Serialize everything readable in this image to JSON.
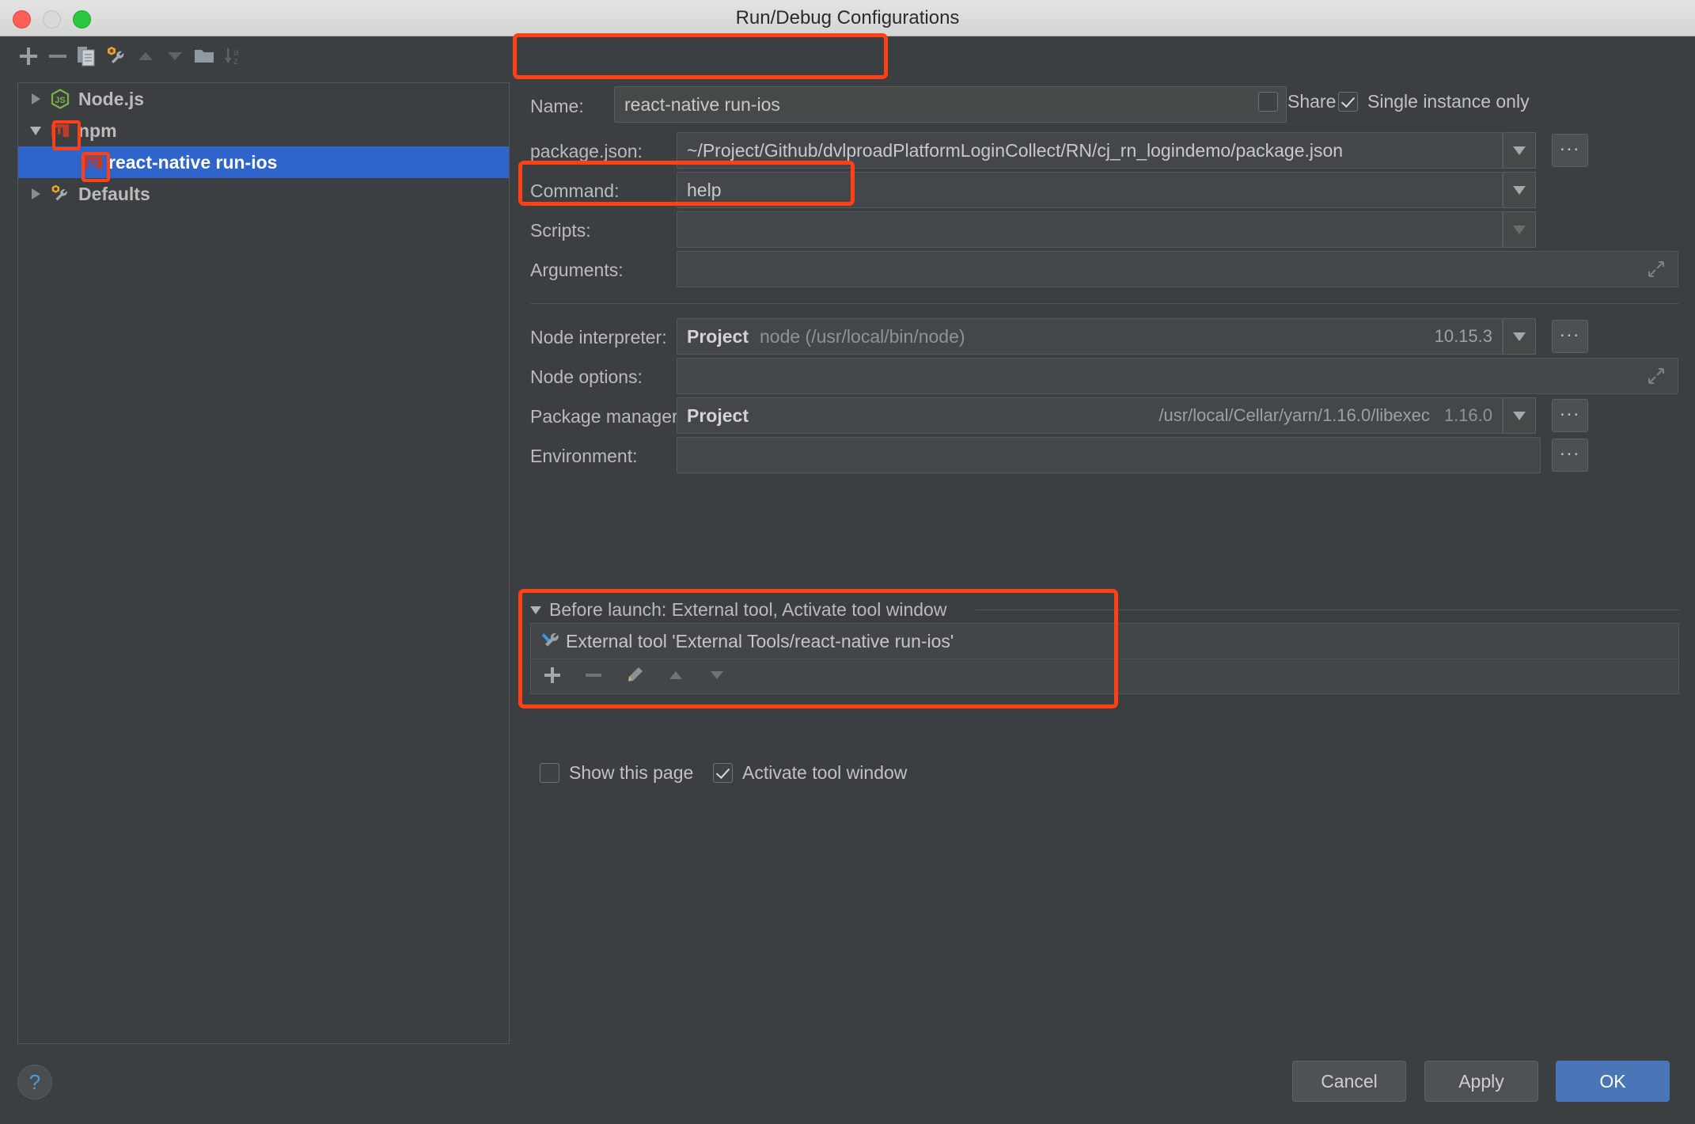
{
  "window": {
    "title": "Run/Debug Configurations",
    "traffic_lights": [
      "close",
      "minimize",
      "maximize"
    ]
  },
  "toolbar": {
    "buttons": [
      {
        "name": "add-configuration",
        "icon": "plus-icon"
      },
      {
        "name": "remove-configuration",
        "icon": "minus-icon"
      },
      {
        "name": "copy-configuration",
        "icon": "copy-icon"
      },
      {
        "name": "edit-templates",
        "icon": "wrench-gear-icon"
      },
      {
        "name": "move-up",
        "icon": "arrow-up-icon"
      },
      {
        "name": "move-down",
        "icon": "arrow-down-icon"
      },
      {
        "name": "create-folder",
        "icon": "folder-icon"
      },
      {
        "name": "sort-configurations",
        "icon": "sort-az-icon"
      }
    ]
  },
  "tree": {
    "items": [
      {
        "label": "Node.js",
        "icon": "nodejs-icon",
        "twisty": "right",
        "level": 1,
        "selected": false
      },
      {
        "label": "npm",
        "icon": "npm-icon",
        "twisty": "down",
        "level": 1,
        "selected": false
      },
      {
        "label": "react-native run-ios",
        "icon": "npm-icon",
        "twisty": "none",
        "level": 2,
        "selected": true
      },
      {
        "label": "Defaults",
        "icon": "wrench-gear-icon",
        "twisty": "right",
        "level": 1,
        "selected": false
      }
    ]
  },
  "form": {
    "name": {
      "label": "Name:",
      "value": "react-native run-ios"
    },
    "share": {
      "label": "Share",
      "checked": false
    },
    "single_instance": {
      "label": "Single instance only",
      "checked": true
    },
    "package_json": {
      "label": "package.json:",
      "value": "~/Project/Github/dvlproadPlatformLoginCollect/RN/cj_rn_logindemo/package.json",
      "browse_label": "..."
    },
    "command": {
      "label": "Command:",
      "value": "help"
    },
    "scripts": {
      "label": "Scripts:",
      "value": ""
    },
    "arguments": {
      "label": "Arguments:",
      "value": ""
    },
    "node_interpreter": {
      "label": "Node interpreter:",
      "scope": "Project",
      "value": "node (/usr/local/bin/node)",
      "version": "10.15.3",
      "browse_label": "..."
    },
    "node_options": {
      "label": "Node options:",
      "value": ""
    },
    "package_manager": {
      "label": "Package manager:",
      "scope": "Project",
      "path": "/usr/local/Cellar/yarn/1.16.0/libexec",
      "version": "1.16.0",
      "browse_label": "..."
    },
    "environment": {
      "label": "Environment:",
      "value": "",
      "browse_label": "..."
    },
    "before_launch": {
      "header": "Before launch: External tool, Activate tool window",
      "items": [
        {
          "icon": "external-tool-icon",
          "label": "External tool 'External Tools/react-native run-ios'"
        }
      ],
      "toolbar": [
        {
          "name": "add-task",
          "icon": "plus-icon"
        },
        {
          "name": "remove-task",
          "icon": "minus-icon"
        },
        {
          "name": "edit-task",
          "icon": "pencil-icon"
        },
        {
          "name": "move-task-up",
          "icon": "arrow-up-icon"
        },
        {
          "name": "move-task-down",
          "icon": "arrow-down-icon"
        }
      ]
    },
    "show_this_page": {
      "label": "Show this page",
      "checked": false
    },
    "activate_tool_window": {
      "label": "Activate tool window",
      "checked": true
    }
  },
  "footer": {
    "help_label": "?",
    "cancel_label": "Cancel",
    "apply_label": "Apply",
    "ok_label": "OK"
  },
  "annotations": {
    "highlight_color": "#ff4015",
    "boxes": [
      "name-field",
      "npm-icon-tree",
      "react-native-item-icon",
      "command-field",
      "before-launch-block"
    ]
  }
}
